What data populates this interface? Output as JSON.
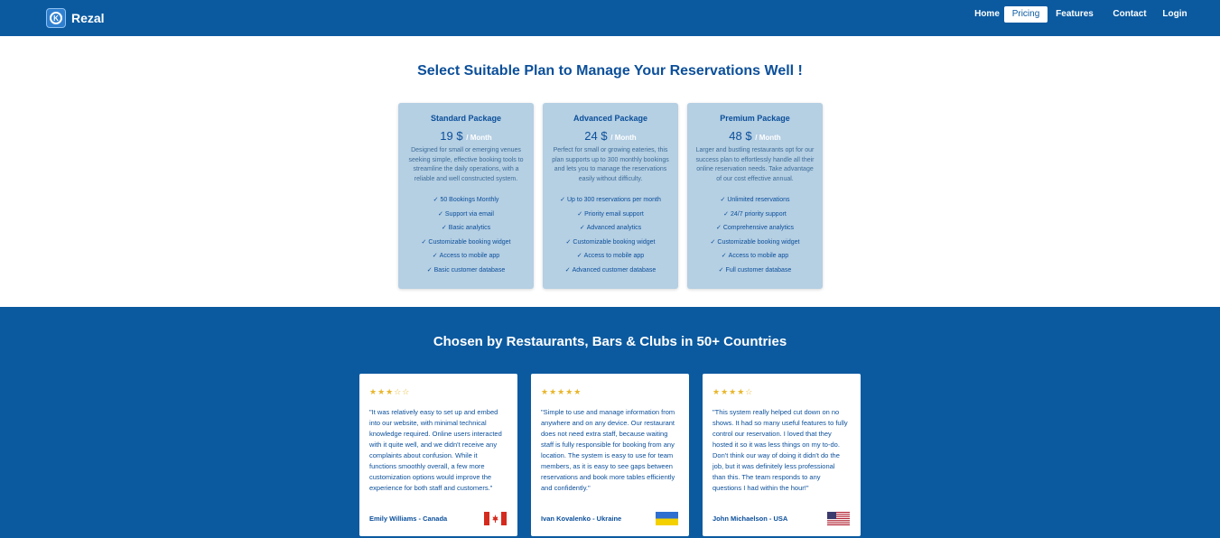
{
  "nav": {
    "brand": "Rezal",
    "links": [
      {
        "label": "Home"
      },
      {
        "label": "Pricing"
      },
      {
        "label": "Features"
      },
      {
        "label": "Contact"
      },
      {
        "label": "Login"
      }
    ]
  },
  "pricing": {
    "title": "Select Suitable Plan to Manage Your Reservations Well !",
    "currency": "$",
    "period": "/ Month",
    "plans": [
      {
        "name": "Standard Package",
        "price": "19",
        "description": "Designed for small or emerging venues seeking simple, effective booking tools to streamline the daily operations, with a reliable and well constructed system.",
        "features": [
          "50 Bookings Monthly",
          "Support via email",
          "Basic analytics",
          "Customizable booking widget",
          "Access to mobile app",
          "Basic customer database"
        ]
      },
      {
        "name": "Advanced Package",
        "price": "24",
        "description": "Perfect for small or growing eateries, this plan supports up to 300 monthly bookings and lets you to manage the reservations easily without difficulty.",
        "features": [
          "Up to 300 reservations per month",
          "Priority email support",
          "Advanced analytics",
          "Customizable booking widget",
          "Access to mobile app",
          "Advanced customer database"
        ]
      },
      {
        "name": "Premium Package",
        "price": "48",
        "description": "Larger and bustling restaurants opt for our success plan to effortlessly handle all their online reservation needs. Take advantage of our cost effective annual.",
        "features": [
          "Unlimited reservations",
          "24/7 priority support",
          "Comprehensive analytics",
          "Customizable booking widget",
          "Access to mobile app",
          "Full customer database"
        ]
      }
    ]
  },
  "testimonials": {
    "title": "Chosen by Restaurants, Bars & Clubs in 50+ Countries",
    "items": [
      {
        "stars": "★★★☆☆",
        "rating": 3,
        "quote": "\"It was relatively easy to set up and embed into our website, with minimal technical knowledge required. Online users interacted with it quite well, and we didn't receive any complaints about confusion. While it functions smoothly overall, a few more customization options would improve the experience for both staff and customers.\"",
        "author": "Emily Williams - Canada",
        "flag_icon": "canada-flag-icon"
      },
      {
        "stars": "★★★★★",
        "rating": 5,
        "quote": "\"Simple to use and manage information from anywhere and on any device. Our restaurant does not need extra staff, because waiting staff is fully responsible for booking from any location. The system is easy to use for team members, as it is easy to see gaps between reservations and book more tables efficiently and confidently.\"",
        "author": "Ivan Kovalenko - Ukraine",
        "flag_icon": "ukraine-flag-icon"
      },
      {
        "stars": "★★★★☆",
        "rating": 4,
        "quote": "\"This system really helped cut down on no shows. It had so many useful features to fully control our reservation. I loved that they hosted it so it was less things on my to-do. Don't think our way of doing it didn't do the job, but it was definitely less professional than this. The team responds to any questions I had within the hour!\"",
        "author": "John Michaelson - USA",
        "flag_icon": "usa-flag-icon"
      }
    ]
  },
  "colors": {
    "primary": "#0b5aa0",
    "card_bg": "#b5cfe3",
    "star": "#e8b62c"
  }
}
